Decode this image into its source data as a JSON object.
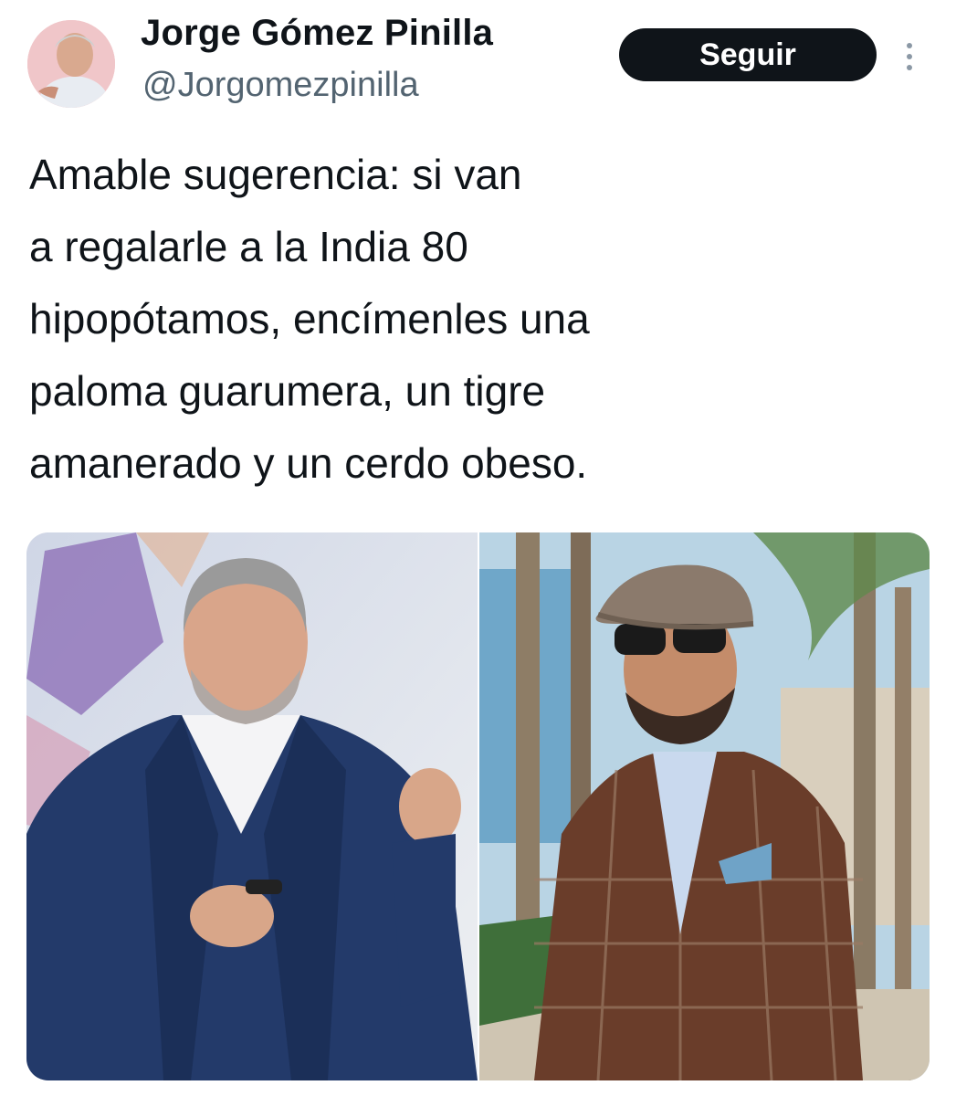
{
  "author": {
    "display_name": "Jorge Gómez Pinilla",
    "handle": "@Jorgomezpinilla",
    "avatar_icon": "avatar-photo"
  },
  "actions": {
    "follow_label": "Seguir",
    "more_icon": "more-vertical-icon"
  },
  "tweet": {
    "lines": [
      "Amable sugerencia: si van",
      "a regalarle a la India 80",
      "hipopótamos, encímenles una",
      "paloma guarumera, un tigre",
      "amanerado y un cerdo obeso."
    ]
  },
  "media": {
    "images": [
      {
        "description_icon": "photo-man-in-blue-suit"
      },
      {
        "description_icon": "photo-man-in-cap-and-plaid-jacket"
      }
    ]
  },
  "colors": {
    "text": "#0f1419",
    "secondary": "#536471",
    "button_bg": "#0f1419",
    "button_text": "#ffffff"
  }
}
